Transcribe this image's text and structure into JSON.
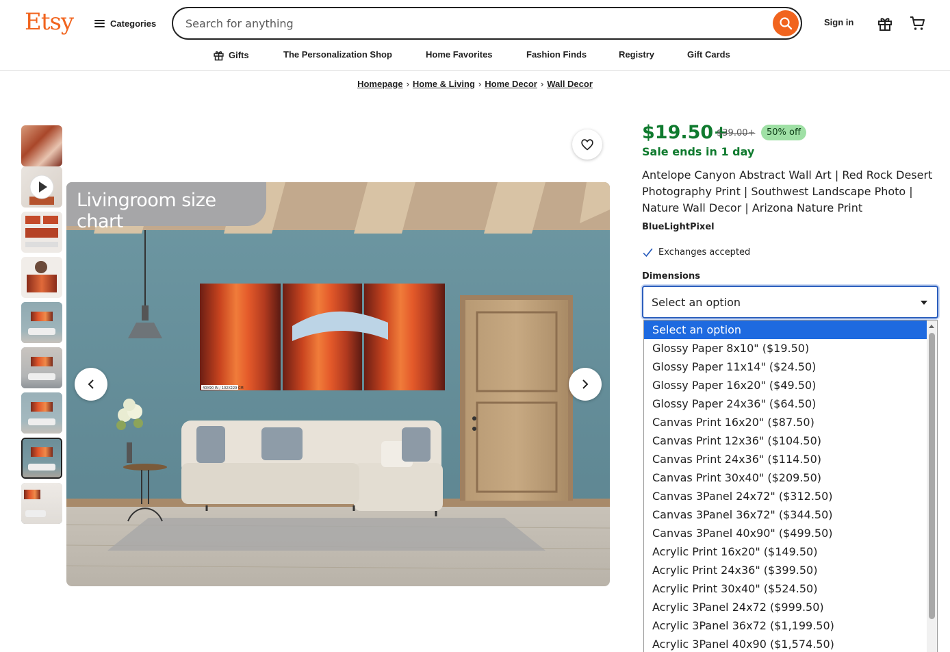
{
  "header": {
    "logo": "Etsy",
    "categories_label": "Categories",
    "search_placeholder": "Search for anything",
    "signin_label": "Sign in"
  },
  "nav": {
    "items": [
      "Gifts",
      "The Personalization Shop",
      "Home Favorites",
      "Fashion Finds",
      "Registry",
      "Gift Cards"
    ]
  },
  "breadcrumb": [
    "Homepage",
    "Home & Living",
    "Home Decor",
    "Wall Decor"
  ],
  "gallery": {
    "label": "Livingroom size chart",
    "thumb_count": 9,
    "selected_thumb": 8,
    "print_caption": "40X90 IN / 102X229 CM"
  },
  "product": {
    "price": "$19.50+",
    "original_price": "$39.00+",
    "discount": "50% off",
    "sale_ends": "Sale ends in 1 day",
    "title": "Antelope Canyon Abstract Wall Art | Red Rock Desert Photography Print | Southwest Landscape Photo | Nature Wall Decor | Arizona Nature Print",
    "shop": "BlueLightPixel",
    "exchanges": "Exchanges accepted",
    "dimensions_label": "Dimensions",
    "select_value": "Select an option"
  },
  "dropdown": {
    "options": [
      "Select an option",
      "Glossy Paper 8x10\" ($19.50)",
      "Glossy Paper 11x14\" ($24.50)",
      "Glossy Paper 16x20\" ($49.50)",
      "Glossy Paper 24x36\" ($64.50)",
      "Canvas Print 16x20\" ($87.50)",
      "Canvas Print 12x36\" ($104.50)",
      "Canvas Print 24x36\" ($114.50)",
      "Canvas Print 30x40\" ($209.50)",
      "Canvas 3Panel 24x72\" ($312.50)",
      "Canvas 3Panel 36x72\" ($344.50)",
      "Canvas 3Panel 40x90\" ($499.50)",
      "Acrylic Print 16x20\" ($149.50)",
      "Acrylic Print 24x36\" ($399.50)",
      "Acrylic Print 30x40\" ($524.50)",
      "Acrylic 3Panel 24x72 ($999.50)",
      "Acrylic 3Panel 36x72 ($1,199.50)",
      "Acrylic 3Panel 40x90 ($1,574.50)"
    ],
    "highlighted_index": 0
  },
  "colors": {
    "brand": "#f1641e",
    "sale_green": "#0f7a2e",
    "discount_bg": "#9fe0a5",
    "focus_blue": "#2b5ebd",
    "highlight": "#1e6ae0"
  },
  "icons": [
    "hamburger-icon",
    "search-icon",
    "gift-icon",
    "cart-icon",
    "heart-icon",
    "chevron-left-icon",
    "chevron-right-icon",
    "play-icon",
    "check-icon",
    "caret-down-icon"
  ]
}
